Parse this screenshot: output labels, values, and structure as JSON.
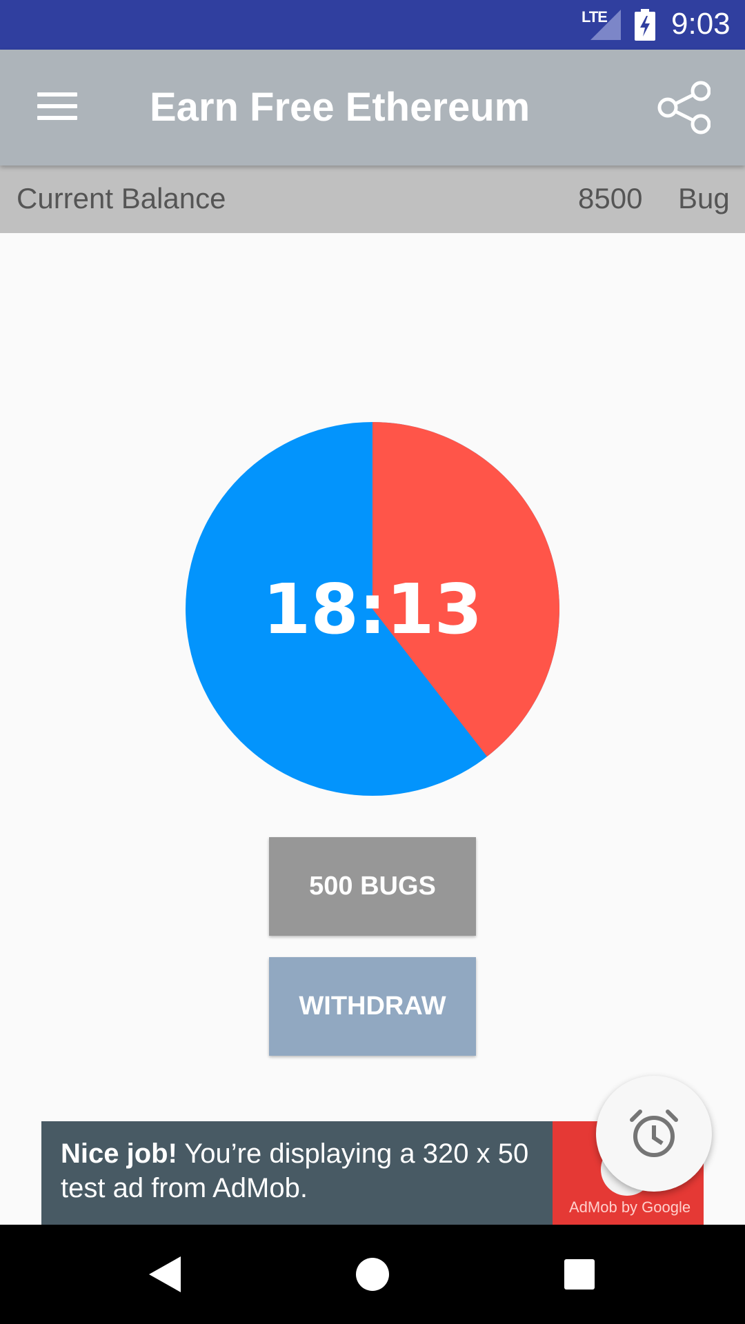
{
  "status_bar": {
    "network": "LTE",
    "time": "9:03",
    "icons": [
      "lte-signal-icon",
      "battery-charging-icon"
    ]
  },
  "app_bar": {
    "title": "Earn Free Ethereum",
    "icons": {
      "menu": "hamburger-menu-icon",
      "share": "share-icon"
    }
  },
  "balance": {
    "label": "Current Balance",
    "value": "8500",
    "unit": "Bug"
  },
  "timer": {
    "text": "18:13",
    "progress_fraction": 0.395,
    "colors": {
      "elapsed": "#ff5549",
      "remaining": "#0394fc"
    }
  },
  "buttons": {
    "bugs_label": "500 BUGS",
    "withdraw_label": "WITHDRAW"
  },
  "ad": {
    "bold_text": "Nice job!",
    "text": " You’re displaying a 320 x 50 test ad from AdMob.",
    "brand": "AdMob by Google"
  },
  "fab": {
    "icon": "alarm-clock-icon"
  },
  "nav_bar": {
    "icons": [
      "back-icon",
      "home-icon",
      "recents-icon"
    ]
  }
}
